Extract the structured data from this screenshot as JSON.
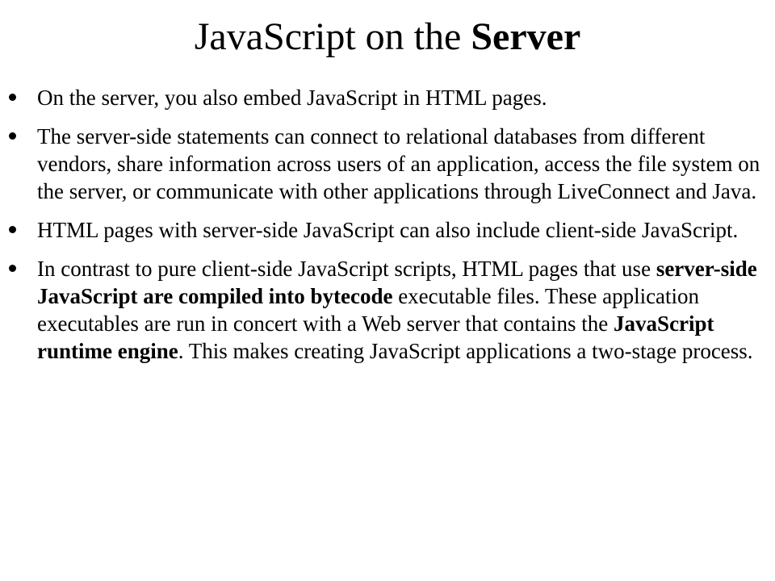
{
  "slide": {
    "title_regular": "JavaScript on the ",
    "title_bold": "Server",
    "bullets": [
      {
        "text": "On the server, you also embed JavaScript in HTML pages."
      },
      {
        "text": "The server-side statements can connect to relational databases from different vendors, share information across users of an application, access the file system on the server, or communicate with other applications through LiveConnect and Java."
      },
      {
        "text": "HTML pages with server-side JavaScript can also include client-side JavaScript."
      },
      {
        "part1": "In contrast to pure client-side JavaScript scripts, HTML pages that use ",
        "bold1": "server-side JavaScript are compiled into bytecode",
        "part2": " executable files. These application executables are run in concert with a Web server that contains the ",
        "bold2": "JavaScript runtime engine",
        "part3": ". This makes creating JavaScript applications a two-stage process."
      }
    ]
  }
}
